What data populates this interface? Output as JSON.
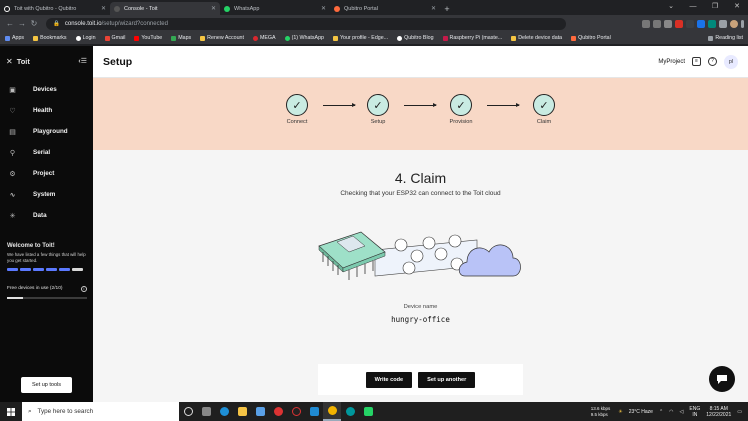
{
  "browser": {
    "tabs": [
      {
        "title": "Toit with Qubitro - Qubitro",
        "color": "#ffffff",
        "active": false
      },
      {
        "title": "Console - Toit",
        "color": "#222222",
        "active": true
      },
      {
        "title": "WhatsApp",
        "color": "#25d366",
        "active": false
      },
      {
        "title": "Qubitro Portal",
        "color": "#ff6a3d",
        "active": false
      }
    ],
    "url_host": "console.toit.io",
    "url_path": "/setup/wizard?connected",
    "bookmarks": [
      {
        "label": "Apps",
        "color": "#5f8cf1"
      },
      {
        "label": "Bookmarks",
        "color": "#f5c542"
      },
      {
        "label": "Login",
        "color": "#ffffff"
      },
      {
        "label": "Gmail",
        "color": "#ea4335"
      },
      {
        "label": "YouTube",
        "color": "#ff0000"
      },
      {
        "label": "Maps",
        "color": "#34a853"
      },
      {
        "label": "Renew Account",
        "color": "#f5c542"
      },
      {
        "label": "MEGA",
        "color": "#d9272e"
      },
      {
        "label": "(1) WhatsApp",
        "color": "#25d366"
      },
      {
        "label": "Your profile - Edge...",
        "color": "#f5c542"
      },
      {
        "label": "Qubitro Blog",
        "color": "#ffffff"
      },
      {
        "label": "Raspberry Pi (maste...",
        "color": "#c51a4a"
      },
      {
        "label": "Delete device data",
        "color": "#f5c542"
      },
      {
        "label": "Qubitro Portal",
        "color": "#ff6a3d"
      }
    ],
    "reading_list": "Reading list"
  },
  "sidebar": {
    "brand": "Toit",
    "items": [
      {
        "label": "Devices",
        "icon": "devices-icon"
      },
      {
        "label": "Health",
        "icon": "health-icon"
      },
      {
        "label": "Playground",
        "icon": "playground-icon"
      },
      {
        "label": "Serial",
        "icon": "serial-icon"
      },
      {
        "label": "Project",
        "icon": "project-icon"
      },
      {
        "label": "System",
        "icon": "system-icon"
      },
      {
        "label": "Data",
        "icon": "data-icon"
      }
    ],
    "welcome_title": "Welcome to Toit!",
    "welcome_text": "We have listed a few things that will help you get started.",
    "welcome_progress": {
      "done": 5,
      "total": 6
    },
    "free_devices": "Free devices in use (2/10)",
    "free_devices_fraction": 0.2,
    "setup_tools": "Set up tools"
  },
  "header": {
    "title": "Setup",
    "project": "MyProject",
    "avatar": "pl"
  },
  "stepper": {
    "steps": [
      "Connect",
      "Setup",
      "Provision",
      "Claim"
    ]
  },
  "claim": {
    "title": "4. Claim",
    "subtitle": "Checking that your ESP32 can connect to the Toit cloud",
    "device_label": "Device name",
    "device_name": "hungry-office",
    "write_code": "Write code",
    "setup_another": "Set up another"
  },
  "taskbar": {
    "search_placeholder": "Type here to search",
    "net_up": "13.6 kbps",
    "net_down": "9.5 kbps",
    "weather": "23°C  Haze",
    "lang": "ENG",
    "region": "IN",
    "time": "8:15 AM",
    "date": "12/22/2021"
  }
}
